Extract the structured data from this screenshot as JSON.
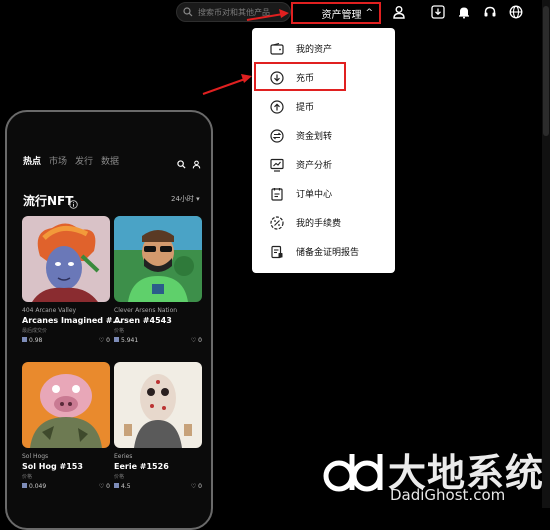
{
  "search": {
    "placeholder": "搜索币对和其他产品"
  },
  "asset_menu": {
    "label": "资产管理"
  },
  "dropdown": {
    "items": [
      {
        "label": "我的资产",
        "icon": "wallet-icon"
      },
      {
        "label": "充币",
        "icon": "deposit-icon"
      },
      {
        "label": "提币",
        "icon": "withdraw-icon"
      },
      {
        "label": "资金划转",
        "icon": "transfer-icon"
      },
      {
        "label": "资产分析",
        "icon": "analysis-icon"
      },
      {
        "label": "订单中心",
        "icon": "orders-icon"
      },
      {
        "label": "我的手续费",
        "icon": "fee-icon"
      },
      {
        "label": "储备金证明报告",
        "icon": "reserve-icon"
      }
    ]
  },
  "phone": {
    "tabs": [
      "热点",
      "市场",
      "发行",
      "数据"
    ],
    "section_title": "流行NFT",
    "period": "24小时 ▾",
    "cards": [
      {
        "collection": "404 Arcane Valley",
        "name": "Arcanes Imagined #...",
        "label": "最后成交价",
        "price": "0.98",
        "likes": "0"
      },
      {
        "collection": "Clever Arsens Nation",
        "name": "Arsen #4543",
        "label": "价格",
        "price": "5.941",
        "likes": "0"
      },
      {
        "collection": "Sol Hogs",
        "name": "Sol Hog #153",
        "label": "价格",
        "price": "0.049",
        "likes": "0"
      },
      {
        "collection": "Eeries",
        "name": "Eerie #1526",
        "label": "价格",
        "price": "4.5",
        "likes": "0"
      }
    ]
  },
  "watermark": {
    "text_cn": "大地系统",
    "text_en": "DadiGhost.com"
  },
  "colors": {
    "highlight": "#e02020",
    "background": "#000000",
    "menu_bg": "#ffffff"
  }
}
